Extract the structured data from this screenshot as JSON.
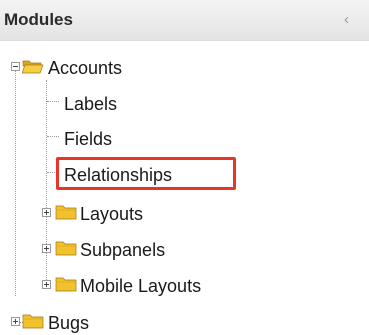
{
  "panel": {
    "title": "Modules",
    "collapse_glyph": "‹"
  },
  "tree": {
    "accounts": {
      "label": "Accounts",
      "state": "expanded",
      "children": {
        "labels": "Labels",
        "fields": "Fields",
        "relationships": "Relationships",
        "layouts": "Layouts",
        "subpanels": "Subpanels",
        "mobile_layouts": "Mobile Layouts"
      }
    },
    "bugs": {
      "label": "Bugs",
      "state": "collapsed"
    }
  },
  "selected": "Relationships",
  "colors": {
    "highlight": "#e8352a",
    "folder": "#f2c12e"
  },
  "icons": {
    "folder": "folder-icon",
    "open_folder": "open-folder-icon",
    "expand": "plus-icon",
    "collapse": "minus-icon"
  }
}
